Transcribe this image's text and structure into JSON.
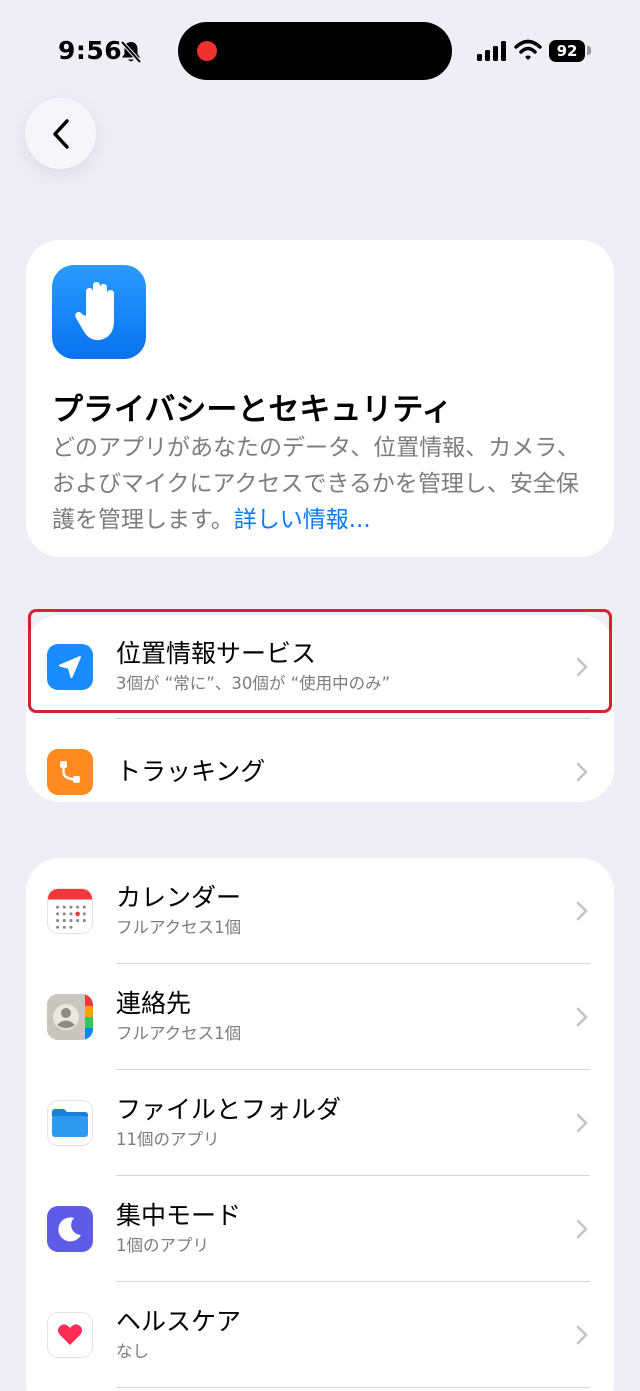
{
  "status_bar": {
    "time": "9:56",
    "battery": "92"
  },
  "header": {
    "title": "プライバシーとセキュリティ",
    "description": "どのアプリがあなたのデータ、位置情報、カメラ、およびマイクにアクセスできるかを管理し、安全保護を管理します。",
    "learn_more": "詳しい情報..."
  },
  "group1": {
    "location": {
      "title": "位置情報サービス",
      "subtitle": "3個が “常に”、30個が “使用中のみ”"
    },
    "tracking": {
      "title": "トラッキング"
    }
  },
  "group2": {
    "calendar": {
      "title": "カレンダー",
      "subtitle": "フルアクセス1個"
    },
    "contacts": {
      "title": "連絡先",
      "subtitle": "フルアクセス1個"
    },
    "files": {
      "title": "ファイルとフォルダ",
      "subtitle": "11個のアプリ"
    },
    "focus": {
      "title": "集中モード",
      "subtitle": "1個のアプリ"
    },
    "health": {
      "title": "ヘルスケア",
      "subtitle": "なし"
    }
  },
  "colors": {
    "accent": "#0a7aff",
    "highlight_border": "#d3252e",
    "background": "#efeef6"
  },
  "icons": [
    "back-chevron-icon",
    "raised-hand-icon",
    "location-arrow-icon",
    "tracking-icon",
    "calendar-icon",
    "contacts-icon",
    "folder-icon",
    "moon-icon",
    "heart-icon",
    "chevron-right-icon"
  ]
}
